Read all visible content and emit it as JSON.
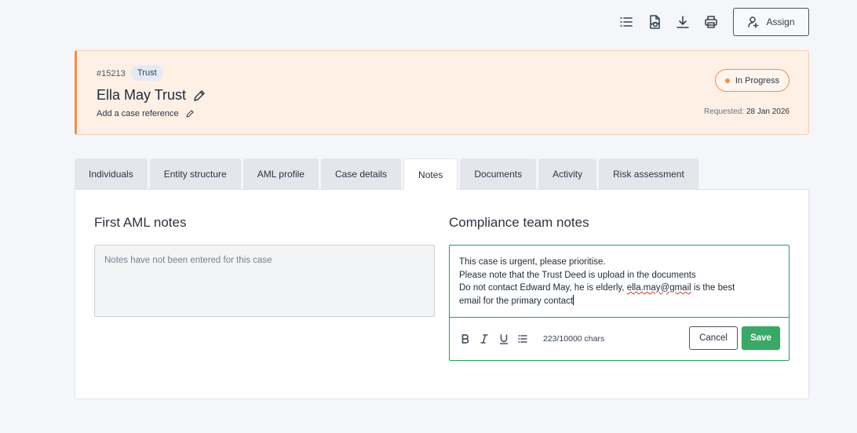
{
  "toolbar": {
    "icons": [
      "list-icon",
      "view-document-icon",
      "download-icon",
      "print-icon"
    ],
    "assign_label": "Assign"
  },
  "case": {
    "id": "#15213",
    "type_badge": "Trust",
    "name": "Ella May Trust",
    "reference_placeholder": "Add a case reference",
    "status": "In Progress",
    "requested_label": "Requested:",
    "requested_date": "28 Jan 2026"
  },
  "tabs": [
    {
      "label": "Individuals",
      "active": false
    },
    {
      "label": "Entity structure",
      "active": false
    },
    {
      "label": "AML profile",
      "active": false
    },
    {
      "label": "Case details",
      "active": false
    },
    {
      "label": "Notes",
      "active": true
    },
    {
      "label": "Documents",
      "active": false
    },
    {
      "label": "Activity",
      "active": false
    },
    {
      "label": "Risk assessment",
      "active": false
    }
  ],
  "first_aml": {
    "title": "First AML notes",
    "empty_text": "Notes have not been entered for this case"
  },
  "compliance": {
    "title": "Compliance team notes",
    "lines": [
      "This case is urgent, please prioritise.",
      "Please note that the Trust Deed is upload in the documents",
      "Do not contact Edward May, he is elderly, ",
      "ella.may@gmail",
      " is the best",
      "email for the primary contact"
    ],
    "char_count": "223/10000 chars",
    "cancel_label": "Cancel",
    "save_label": "Save"
  },
  "colors": {
    "accent_orange": "#f28c4f",
    "save_green": "#3aa866",
    "header_bg": "#fff0e6"
  }
}
